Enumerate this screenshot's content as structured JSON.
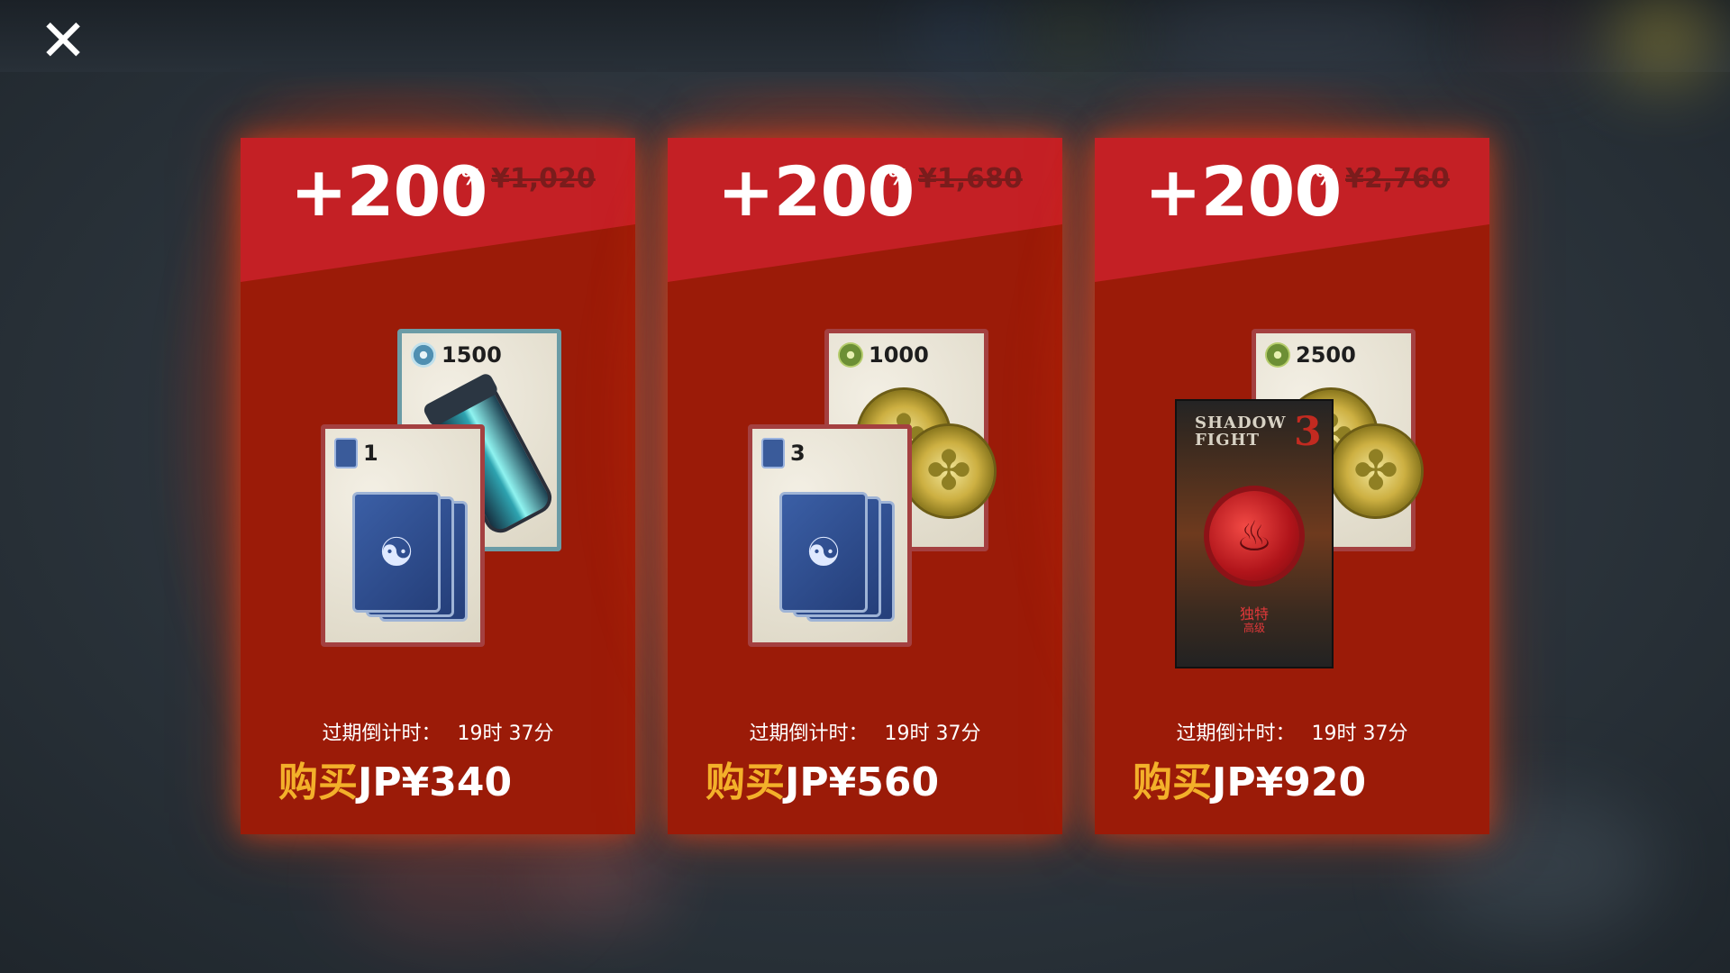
{
  "close_button": {
    "icon": "close-icon",
    "glyph": "✕"
  },
  "offers": [
    {
      "bonus": "+200",
      "bonus_unit": "%",
      "old_price": "¥1,020",
      "items": [
        {
          "icon": "energy-swirl-icon",
          "quantity": "1500"
        },
        {
          "icon": "card-pack-icon",
          "quantity": "1"
        }
      ],
      "timer_label": "过期倒计时：",
      "timer_value": "19时 37分",
      "buy_label": "购买",
      "buy_price": "JP¥340"
    },
    {
      "bonus": "+200",
      "bonus_unit": "%",
      "old_price": "¥1,680",
      "items": [
        {
          "icon": "coin-icon",
          "quantity": "1000"
        },
        {
          "icon": "card-pack-icon",
          "quantity": "3"
        }
      ],
      "timer_label": "过期倒计时：",
      "timer_value": "19时 37分",
      "buy_label": "购买",
      "buy_price": "JP¥560"
    },
    {
      "bonus": "+200",
      "bonus_unit": "%",
      "old_price": "¥2,760",
      "items": [
        {
          "icon": "coin-icon",
          "quantity": "2500"
        },
        {
          "icon": "shadow-fight-3-pack",
          "quantity": ""
        }
      ],
      "pack": {
        "logo": "SHADOW FIGHT",
        "logo_number": "3",
        "tag": "独特",
        "tag_sub": "高级"
      },
      "timer_label": "过期倒计时：",
      "timer_value": "19时 37分",
      "buy_label": "购买",
      "buy_price": "JP¥920"
    }
  ],
  "colors": {
    "card": "#9b1b08",
    "header": "#c42025",
    "buy_label": "#f3b02a"
  }
}
